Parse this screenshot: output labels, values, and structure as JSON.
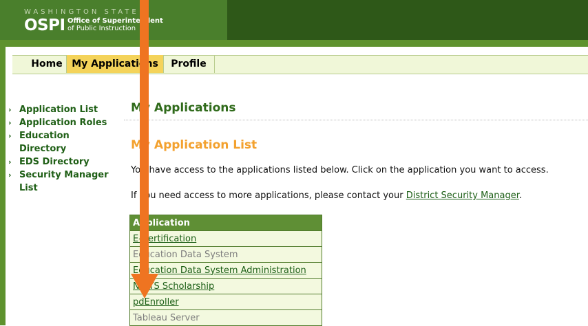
{
  "header": {
    "state_text": "WASHINGTON STATE",
    "logo_mark": "OSPI",
    "org_line1": "Office of Superintendent",
    "org_line2": "of Public Instruction"
  },
  "tabs": [
    {
      "label": "Home"
    },
    {
      "label": "My Applications",
      "active": true
    },
    {
      "label": "Profile"
    }
  ],
  "sidebar": {
    "items": [
      {
        "label": "Application List"
      },
      {
        "label": "Application Roles"
      },
      {
        "label": "Education Directory"
      },
      {
        "label": "EDS Directory"
      },
      {
        "label": "Security Manager List"
      }
    ]
  },
  "main": {
    "title": "My Applications",
    "subtitle": "My Application List",
    "intro": "You have access to the applications listed below. Click on the application you want to access.",
    "contact_prefix": "If you need access to more applications, please contact your ",
    "contact_link": "District Security Manager",
    "contact_suffix": "."
  },
  "table": {
    "header": "Application",
    "rows": [
      {
        "label": "E-Certification",
        "style": "link"
      },
      {
        "label": "Education Data System",
        "style": "grey"
      },
      {
        "label": "Education Data System Administration",
        "style": "link"
      },
      {
        "label": "NWTS Scholarship",
        "style": "link"
      },
      {
        "label": "pdEnroller",
        "style": "link"
      },
      {
        "label": "Tableau Server",
        "style": "grey"
      }
    ]
  },
  "colors": {
    "header_green": "#4a7f2c",
    "accent_orange": "#f3a12e",
    "annotation_arrow": "#ef7421",
    "active_tab": "#f4d35a"
  }
}
